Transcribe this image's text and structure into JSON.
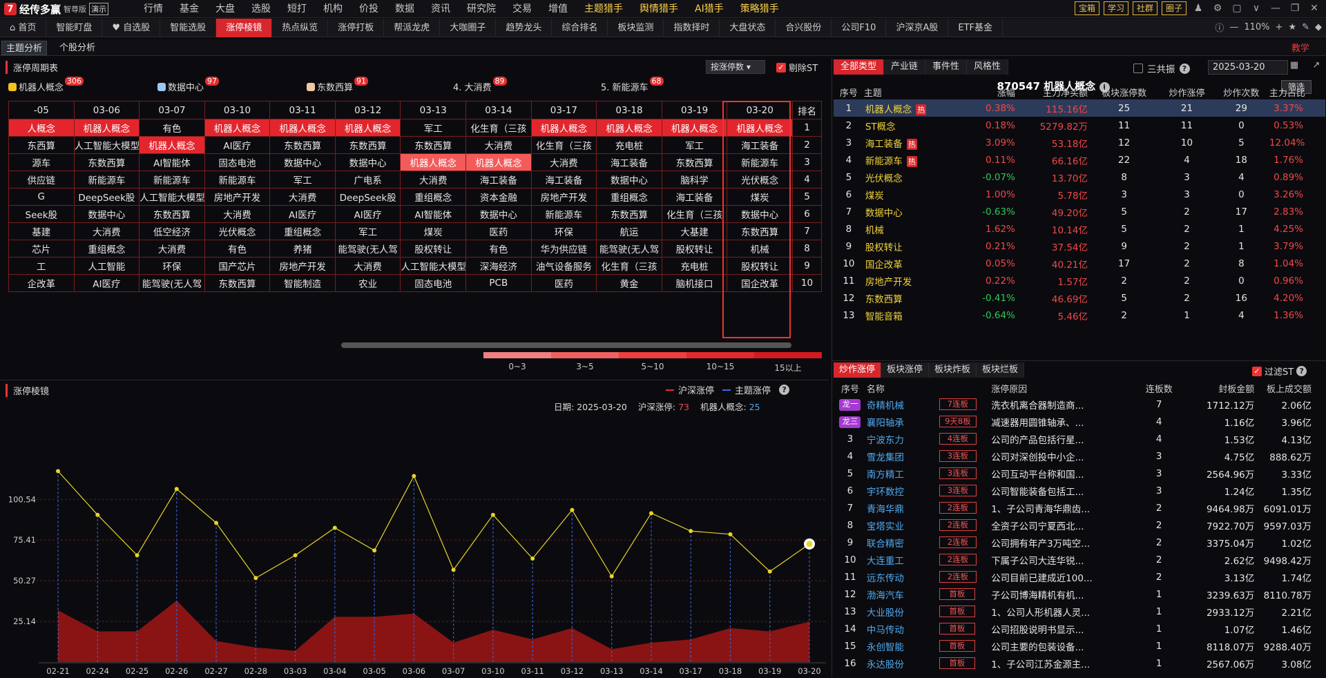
{
  "app": {
    "name": "经传多赢",
    "edition": "智尊版",
    "demo_label": "演示"
  },
  "main_nav": [
    "行情",
    "基金",
    "大盘",
    "选股",
    "短打",
    "机构",
    "价投",
    "数据",
    "资讯",
    "研究院",
    "交易",
    "增值",
    "主题猎手",
    "舆情猎手",
    "AI猎手",
    "策略猎手"
  ],
  "top_tools": [
    "宝箱",
    "学习",
    "社群",
    "圈子"
  ],
  "sub_nav": [
    "首页",
    "智能盯盘",
    "自选股",
    "智能选股",
    "涨停棱镜",
    "热点纵览",
    "涨停打板",
    "帮派龙虎",
    "大咖圈子",
    "趋势龙头",
    "综合排名",
    "板块监测",
    "指数择时",
    "大盘状态",
    "合兴股份",
    "公司F10",
    "沪深京A股",
    "ETF基金"
  ],
  "zoom": "110%",
  "tabs3": [
    "主题分析",
    "个股分析"
  ],
  "teach_label": "教学",
  "cycle": {
    "title": "涨停周期表",
    "sort_label": "按涨停数",
    "exclude_st": "剔除ST",
    "legend": [
      {
        "label": "机器人概念",
        "count": "306",
        "color": "#f3c31d"
      },
      {
        "label": "数据中心",
        "count": "97",
        "color": "#9bc8f0"
      },
      {
        "label": "东数西算",
        "count": "91",
        "color": "#f0c8a0"
      },
      {
        "label": "4. 大消费",
        "count": "89",
        "color": ""
      },
      {
        "label": "5. 新能源车",
        "count": "68",
        "color": ""
      }
    ],
    "dates": [
      "-05",
      "03-06",
      "03-07",
      "03-10",
      "03-11",
      "03-12",
      "03-13",
      "03-14",
      "03-17",
      "03-18",
      "03-19",
      "03-20"
    ],
    "rank_header": "排名",
    "rows": [
      [
        "人概念",
        "机器人概念",
        "有色",
        "机器人概念",
        "机器人概念",
        "机器人概念",
        "军工",
        "化生育（三孩",
        "机器人概念",
        "机器人概念",
        "机器人概念",
        "机器人概念"
      ],
      [
        "东西算",
        "人工智能大模型",
        "机器人概念",
        "AI医疗",
        "东数西算",
        "东数西算",
        "东数西算",
        "大消费",
        "化生育（三孩",
        "充电桩",
        "军工",
        "海工装备"
      ],
      [
        "源车",
        "东数西算",
        "AI智能体",
        "固态电池",
        "数据中心",
        "数据中心",
        "机器人概念",
        "机器人概念",
        "大消费",
        "海工装备",
        "东数西算",
        "新能源车"
      ],
      [
        "供应链",
        "新能源车",
        "新能源车",
        "新能源车",
        "军工",
        "广电系",
        "大消费",
        "海工装备",
        "海工装备",
        "数据中心",
        "脑科学",
        "光伏概念"
      ],
      [
        "G",
        "DeepSeek股",
        "人工智能大模型",
        "房地产开发",
        "大消费",
        "DeepSeek股",
        "重组概念",
        "资本金融",
        "房地产开发",
        "重组概念",
        "海工装备",
        "煤炭"
      ],
      [
        "Seek股",
        "数据中心",
        "东数西算",
        "大消费",
        "AI医疗",
        "AI医疗",
        "AI智能体",
        "数据中心",
        "新能源车",
        "东数西算",
        "化生育（三孩",
        "数据中心"
      ],
      [
        "基建",
        "大消费",
        "低空经济",
        "光伏概念",
        "重组概念",
        "军工",
        "煤炭",
        "医药",
        "环保",
        "航运",
        "大基建",
        "东数西算"
      ],
      [
        "芯片",
        "重组概念",
        "大消费",
        "有色",
        "养猪",
        "能驾驶(无人驾",
        "股权转让",
        "有色",
        "华为供应链",
        "能驾驶(无人驾",
        "股权转让",
        "机械"
      ],
      [
        "工",
        "人工智能",
        "环保",
        "国产芯片",
        "房地产开发",
        "大消费",
        "人工智能大模型",
        "深海经济",
        "油气设备服务",
        "化生育（三孩",
        "充电桩",
        "股权转让"
      ],
      [
        "企改革",
        "AI医疗",
        "能驾驶(无人驾",
        "东数西算",
        "智能制造",
        "农业",
        "固态电池",
        "PCB",
        "医药",
        "黄金",
        "脑机接口",
        "国企改革"
      ]
    ],
    "ranks": [
      "1",
      "2",
      "3",
      "4",
      "5",
      "6",
      "7",
      "8",
      "9",
      "10"
    ],
    "scale_labels": [
      "0~3",
      "3~5",
      "5~10",
      "10~15",
      "15以上"
    ],
    "scale_colors": [
      "#f08080",
      "#f06060",
      "#ee3e3e",
      "#e5282c",
      "#d41a1f"
    ]
  },
  "prism": {
    "title": "涨停棱镜",
    "legend_a": "沪深涨停",
    "legend_b": "主题涨停",
    "date_label": "日期:",
    "date": "2025-03-20",
    "hs_label": "沪深涨停:",
    "hs_value": "73",
    "theme_label": "机器人概念:",
    "theme_value": "25"
  },
  "chart_data": {
    "type": "line",
    "x": [
      "02-21",
      "02-24",
      "02-25",
      "02-26",
      "02-27",
      "02-28",
      "03-03",
      "03-04",
      "03-05",
      "03-06",
      "03-07",
      "03-10",
      "03-11",
      "03-12",
      "03-13",
      "03-14",
      "03-17",
      "03-18",
      "03-19",
      "03-20"
    ],
    "yticks": [
      25.14,
      50.27,
      75.41,
      100.54
    ],
    "series": [
      {
        "name": "沪深涨停",
        "type": "area",
        "color": "#8a1414",
        "values": [
          32,
          19,
          19,
          38,
          13,
          9,
          7,
          28,
          28,
          30,
          12,
          20,
          14,
          21,
          8,
          12,
          14,
          21,
          19,
          25
        ]
      },
      {
        "name": "主题涨停",
        "type": "line",
        "color": "#e8d42a",
        "values": [
          118,
          91,
          66,
          107,
          86,
          52,
          66,
          83,
          69,
          115,
          57,
          91,
          64,
          94,
          53,
          92,
          81,
          79,
          56,
          73
        ]
      }
    ]
  },
  "right": {
    "tabs": [
      "全部类型",
      "产业链",
      "事件性",
      "风格性"
    ],
    "sangong": "三共振",
    "date": "2025-03-20",
    "title": "870547 机器人概念",
    "filter_btn": "筛选",
    "headers": [
      "序号",
      "主题",
      "涨幅",
      "主力净买额",
      "板块涨停数",
      "炒作涨停",
      "炒作次数",
      "主力占比"
    ],
    "hot_label": "热",
    "rows": [
      {
        "no": "1",
        "name": "机器人概念",
        "hot": true,
        "pct": "0.38%",
        "net": "115.16亿",
        "zt": "25",
        "cz": "21",
        "ci": "29",
        "zb": "3.37%"
      },
      {
        "no": "2",
        "name": "ST概念",
        "hot": false,
        "pct": "0.18%",
        "net": "5279.82万",
        "zt": "11",
        "cz": "11",
        "ci": "0",
        "zb": "0.53%"
      },
      {
        "no": "3",
        "name": "海工装备",
        "hot": true,
        "pct": "3.09%",
        "net": "53.18亿",
        "zt": "12",
        "cz": "10",
        "ci": "5",
        "zb": "12.04%"
      },
      {
        "no": "4",
        "name": "新能源车",
        "hot": true,
        "pct": "0.11%",
        "net": "66.16亿",
        "zt": "22",
        "cz": "4",
        "ci": "18",
        "zb": "1.76%"
      },
      {
        "no": "5",
        "name": "光伏概念",
        "hot": false,
        "pct": "-0.07%",
        "net": "13.70亿",
        "zt": "8",
        "cz": "3",
        "ci": "4",
        "zb": "0.89%"
      },
      {
        "no": "6",
        "name": "煤炭",
        "hot": false,
        "pct": "1.00%",
        "net": "5.78亿",
        "zt": "3",
        "cz": "3",
        "ci": "0",
        "zb": "3.26%"
      },
      {
        "no": "7",
        "name": "数据中心",
        "hot": false,
        "pct": "-0.63%",
        "net": "49.20亿",
        "zt": "5",
        "cz": "2",
        "ci": "17",
        "zb": "2.83%"
      },
      {
        "no": "8",
        "name": "机械",
        "hot": false,
        "pct": "1.62%",
        "net": "10.14亿",
        "zt": "5",
        "cz": "2",
        "ci": "1",
        "zb": "4.25%"
      },
      {
        "no": "9",
        "name": "股权转让",
        "hot": false,
        "pct": "0.21%",
        "net": "37.54亿",
        "zt": "9",
        "cz": "2",
        "ci": "1",
        "zb": "3.79%"
      },
      {
        "no": "10",
        "name": "国企改革",
        "hot": false,
        "pct": "0.05%",
        "net": "40.21亿",
        "zt": "17",
        "cz": "2",
        "ci": "8",
        "zb": "1.04%"
      },
      {
        "no": "11",
        "name": "房地产开发",
        "hot": false,
        "pct": "0.22%",
        "net": "1.57亿",
        "zt": "2",
        "cz": "2",
        "ci": "0",
        "zb": "0.96%"
      },
      {
        "no": "12",
        "name": "东数西算",
        "hot": false,
        "pct": "-0.41%",
        "net": "46.69亿",
        "zt": "5",
        "cz": "2",
        "ci": "16",
        "zb": "4.20%"
      },
      {
        "no": "13",
        "name": "智能音箱",
        "hot": false,
        "pct": "-0.64%",
        "net": "5.46亿",
        "zt": "2",
        "cz": "1",
        "ci": "4",
        "zb": "1.36%"
      }
    ]
  },
  "stocks": {
    "tabs": [
      "炒作涨停",
      "板块涨停",
      "板块炸板",
      "板块烂板"
    ],
    "filter_st": "过滤ST",
    "headers": [
      "序号",
      "名称",
      "",
      "涨停原因",
      "连板数",
      "封板金额",
      "板上成交额"
    ],
    "rows": [
      {
        "no": "龙一",
        "dragon": true,
        "name": "奇精机械",
        "tag": "7连板",
        "reason": "洗衣机离合器制造商...",
        "lb": "7",
        "amt": "1712.12万",
        "vol": "2.06亿"
      },
      {
        "no": "龙三",
        "dragon": true,
        "name": "襄阳轴承",
        "tag": "9天8板",
        "reason": "减速器用圆锥轴承、...",
        "lb": "4",
        "amt": "1.16亿",
        "vol": "3.96亿"
      },
      {
        "no": "3",
        "dragon": false,
        "name": "宁波东力",
        "tag": "4连板",
        "reason": "公司的产品包括行星...",
        "lb": "4",
        "amt": "1.53亿",
        "vol": "4.13亿"
      },
      {
        "no": "4",
        "dragon": false,
        "name": "雪龙集团",
        "tag": "3连板",
        "reason": "公司对深创投中小企...",
        "lb": "3",
        "amt": "4.75亿",
        "vol": "888.62万"
      },
      {
        "no": "5",
        "dragon": false,
        "name": "南方精工",
        "tag": "3连板",
        "reason": "公司互动平台称和国...",
        "lb": "3",
        "amt": "2564.96万",
        "vol": "3.33亿"
      },
      {
        "no": "6",
        "dragon": false,
        "name": "宇环数控",
        "tag": "3连板",
        "reason": "公司智能装备包括工...",
        "lb": "3",
        "amt": "1.24亿",
        "vol": "1.35亿"
      },
      {
        "no": "7",
        "dragon": false,
        "name": "青海华鼎",
        "tag": "2连板",
        "reason": "1、子公司青海华鼎齿...",
        "lb": "2",
        "amt": "9464.98万",
        "vol": "6091.01万"
      },
      {
        "no": "8",
        "dragon": false,
        "name": "宝塔实业",
        "tag": "2连板",
        "reason": "全资子公司宁夏西北...",
        "lb": "2",
        "amt": "7922.70万",
        "vol": "9597.03万"
      },
      {
        "no": "9",
        "dragon": false,
        "name": "联合精密",
        "tag": "2连板",
        "reason": "公司拥有年产3万吨空...",
        "lb": "2",
        "amt": "3375.04万",
        "vol": "1.02亿"
      },
      {
        "no": "10",
        "dragon": false,
        "name": "大连重工",
        "tag": "2连板",
        "reason": "下属子公司大连华锐...",
        "lb": "2",
        "amt": "2.62亿",
        "vol": "9498.42万"
      },
      {
        "no": "11",
        "dragon": false,
        "name": "远东传动",
        "tag": "2连板",
        "reason": "公司目前已建成近100...",
        "lb": "2",
        "amt": "3.13亿",
        "vol": "1.74亿"
      },
      {
        "no": "12",
        "dragon": false,
        "name": "渤海汽车",
        "tag": "首板",
        "reason": "子公司博海精机有机...",
        "lb": "1",
        "amt": "3239.63万",
        "vol": "8110.78万"
      },
      {
        "no": "13",
        "dragon": false,
        "name": "大业股份",
        "tag": "首板",
        "reason": "1、公司人形机器人灵...",
        "lb": "1",
        "amt": "2933.12万",
        "vol": "2.21亿"
      },
      {
        "no": "14",
        "dragon": false,
        "name": "中马传动",
        "tag": "首板",
        "reason": "公司招股说明书显示...",
        "lb": "1",
        "amt": "1.07亿",
        "vol": "1.46亿"
      },
      {
        "no": "15",
        "dragon": false,
        "name": "永创智能",
        "tag": "首板",
        "reason": "公司主要的包装设备...",
        "lb": "1",
        "amt": "8118.07万",
        "vol": "9288.40万"
      },
      {
        "no": "16",
        "dragon": false,
        "name": "永达股份",
        "tag": "首板",
        "reason": "1、子公司江苏金源主...",
        "lb": "1",
        "amt": "2567.06万",
        "vol": "3.08亿"
      }
    ]
  }
}
